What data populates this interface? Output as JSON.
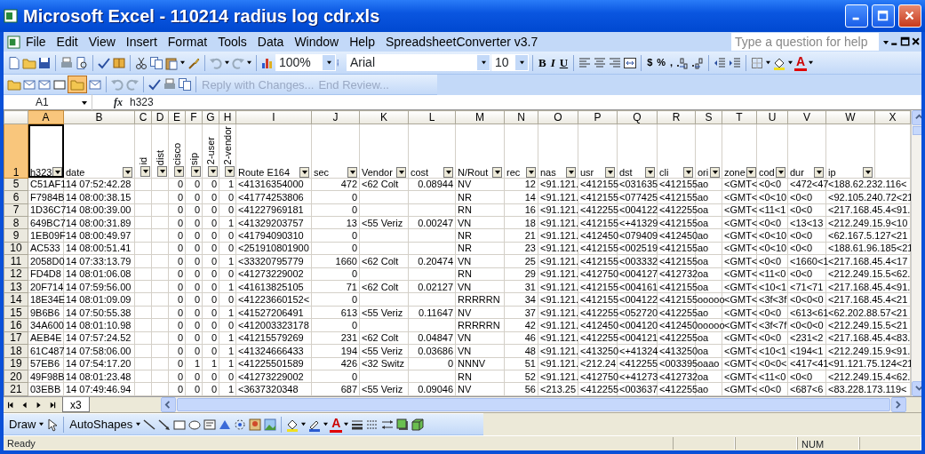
{
  "window": {
    "title": "Microsoft Excel - 110214 radius log cdr.xls"
  },
  "menu": [
    "File",
    "Edit",
    "View",
    "Insert",
    "Format",
    "Tools",
    "Data",
    "Window",
    "Help",
    "SpreadsheetConverter v3.7"
  ],
  "help_box": {
    "placeholder": "Type a question for help"
  },
  "formatting_toolbar": {
    "zoom": "100%",
    "font": "Arial",
    "font_size": "10",
    "style_buttons": [
      "B",
      "I",
      "U"
    ],
    "number_buttons": [
      "$",
      "%",
      ","
    ],
    "font_color_button": "A"
  },
  "reviewing_toolbar": {
    "buttons": [
      {
        "label": "Reply with Changes...",
        "disabled": true
      },
      {
        "label": "End Review...",
        "disabled": true
      }
    ]
  },
  "formula_bar": {
    "name_box": "A1",
    "function_label": "fx",
    "value": "h323"
  },
  "sheet": {
    "header_row": {
      "number": "1",
      "selected": true
    },
    "columns": [
      {
        "letter": "A",
        "header": "h323",
        "kind": "text",
        "rotated": false,
        "filter": true,
        "selected": true
      },
      {
        "letter": "B",
        "header": "date",
        "kind": "text",
        "rotated": false,
        "filter": true,
        "selected": false
      },
      {
        "letter": "C",
        "header": "id",
        "rotated": true,
        "filter": true,
        "selected": false
      },
      {
        "letter": "D",
        "header": "dist",
        "rotated": true,
        "filter": true,
        "selected": false
      },
      {
        "letter": "E",
        "header": "cisco",
        "kind": "number",
        "rotated": true,
        "filter": true,
        "selected": false
      },
      {
        "letter": "F",
        "header": "sip",
        "kind": "number",
        "rotated": true,
        "filter": true,
        "selected": false
      },
      {
        "letter": "G",
        "header": "2-user",
        "kind": "number",
        "rotated": true,
        "filter": true,
        "selected": false
      },
      {
        "letter": "H",
        "header": "2-vendor",
        "kind": "number",
        "rotated": true,
        "filter": true,
        "selected": false
      },
      {
        "letter": "I",
        "header": "Route E164",
        "kind": "text",
        "rotated": false,
        "filter": true,
        "selected": false
      },
      {
        "letter": "J",
        "header": "sec",
        "kind": "number",
        "rotated": false,
        "filter": true,
        "selected": false
      },
      {
        "letter": "K",
        "header": "Vendor",
        "kind": "text",
        "rotated": false,
        "filter": true,
        "selected": false
      },
      {
        "letter": "L",
        "header": "cost",
        "kind": "number",
        "rotated": false,
        "filter": true,
        "selected": false
      },
      {
        "letter": "M",
        "header": "N/Rout",
        "kind": "text",
        "rotated": false,
        "filter": true,
        "selected": false
      },
      {
        "letter": "N",
        "header": "rec",
        "kind": "number",
        "rotated": false,
        "filter": true,
        "selected": false
      },
      {
        "letter": "O",
        "header": "nas",
        "kind": "text",
        "rotated": false,
        "filter": true,
        "selected": false
      },
      {
        "letter": "P",
        "header": "usr",
        "kind": "text",
        "rotated": false,
        "filter": true,
        "selected": false
      },
      {
        "letter": "Q",
        "header": "dst",
        "kind": "text",
        "rotated": false,
        "filter": true,
        "selected": false
      },
      {
        "letter": "R",
        "header": "cli",
        "kind": "text",
        "rotated": false,
        "filter": true,
        "selected": false
      },
      {
        "letter": "S",
        "header": "ori",
        "kind": "text",
        "rotated": false,
        "filter": true,
        "selected": false
      },
      {
        "letter": "T",
        "header": "zone",
        "kind": "text",
        "rotated": false,
        "filter": true,
        "selected": false
      },
      {
        "letter": "U",
        "header": "cod",
        "kind": "text",
        "rotated": false,
        "filter": true,
        "selected": false
      },
      {
        "letter": "V",
        "header": "dur",
        "kind": "text",
        "rotated": false,
        "filter": true,
        "selected": false
      },
      {
        "letter": "W",
        "header": "ip",
        "kind": "text",
        "rotated": false,
        "filter": true,
        "selected": false
      },
      {
        "letter": "X",
        "rotated": false,
        "filter": false,
        "selected": false
      }
    ],
    "rows": [
      {
        "number": "5",
        "cells": [
          "C51AF1",
          "14 07:52:42.28",
          null,
          null,
          "0",
          "0",
          "0",
          "1",
          "<41316354000",
          "472",
          "<62 Colt",
          "0.08944",
          "NV",
          "12",
          "<91.121.",
          "<412155",
          "<031635",
          "<412155",
          "ao",
          "<GMT<",
          "<0<0",
          "<472<47",
          {
            "text": "<188.62.232.116<",
            "colspan": 2
          }
        ]
      },
      {
        "number": "6",
        "cells": [
          "F7984B",
          "14 08:00:38.15",
          null,
          null,
          "0",
          "0",
          "0",
          "0",
          "<41774253806",
          "0",
          null,
          null,
          "NR",
          "14",
          "<91.121.",
          "<412155",
          "<077425",
          "<412155",
          "ao",
          "<GMT<",
          "<0<10",
          "<0<0",
          {
            "text": "<92.105.240.72<21",
            "colspan": 2
          }
        ]
      },
      {
        "number": "7",
        "cells": [
          "1D36C7",
          "14 08:00:39.00",
          null,
          null,
          "0",
          "0",
          "0",
          "0",
          "<41227969181",
          "0",
          null,
          null,
          "RN",
          "16",
          "<91.121.",
          "<412255",
          "<004122",
          "<412255",
          "oa",
          "<GMT<",
          "<11<1",
          "<0<0",
          {
            "text": "<217.168.45.4<91.",
            "colspan": 2
          }
        ]
      },
      {
        "number": "8",
        "cells": [
          "649BC7",
          "14 08:00:31.89",
          null,
          null,
          "0",
          "0",
          "0",
          "1",
          "<41329203757",
          "13",
          "<55 Veriz",
          "0.00247",
          "VN",
          "18",
          "<91.121.",
          "<412155",
          "<+41329",
          "<412155",
          "oa",
          "<GMT<",
          "<0<0",
          "<13<13",
          {
            "text": "<212.249.15.9<10",
            "colspan": 2
          }
        ]
      },
      {
        "number": "9",
        "cells": [
          "1EB09F",
          "14 08:00:49.97",
          null,
          null,
          "0",
          "0",
          "0",
          "0",
          "<41794090310",
          "0",
          null,
          null,
          "NR",
          "21",
          "<91.121.",
          "<412450",
          "<079409",
          "<412450",
          "ao",
          "<GMT<",
          "<0<10",
          "<0<0",
          {
            "text": "<62.167.5.127<21",
            "colspan": 2
          }
        ]
      },
      {
        "number": "10",
        "cells": [
          "AC533",
          "14 08:00:51.41",
          null,
          null,
          "0",
          "0",
          "0",
          "0",
          "<251910801900",
          "0",
          null,
          null,
          "NR",
          "23",
          "<91.121.",
          "<412155",
          "<002519",
          "<412155",
          "ao",
          "<GMT<",
          "<0<10",
          "<0<0",
          {
            "text": "<188.61.96.185<21",
            "colspan": 2
          }
        ]
      },
      {
        "number": "11",
        "cells": [
          "2058D0",
          "14 07:33:13.79",
          null,
          null,
          "0",
          "0",
          "0",
          "1",
          "<33320795779",
          "1660",
          "<62 Colt",
          "0.20474",
          "VN",
          "25",
          "<91.121.",
          "<412155",
          "<003332",
          "<412155",
          "oa",
          "<GMT<",
          "<0<0",
          "<1660<1",
          {
            "text": "<217.168.45.4<17",
            "colspan": 2
          }
        ]
      },
      {
        "number": "12",
        "cells": [
          "FD4D8",
          "14 08:01:06.08",
          null,
          null,
          "0",
          "0",
          "0",
          "0",
          "<41273229002",
          "0",
          null,
          null,
          "RN",
          "29",
          "<91.121.",
          "<412750",
          "<004127",
          "<412732",
          "oa",
          "<GMT<",
          "<11<0",
          "<0<0",
          {
            "text": "<212.249.15.5<62.",
            "colspan": 2
          }
        ]
      },
      {
        "number": "13",
        "cells": [
          "20F714",
          "14 07:59:56.00",
          null,
          null,
          "0",
          "0",
          "0",
          "1",
          "<41613825105",
          "71",
          "<62 Colt",
          "0.02127",
          "VN",
          "31",
          "<91.121.",
          "<412155",
          "<004161",
          "<412155",
          "oa",
          "<GMT<",
          "<10<1",
          "<71<71",
          {
            "text": "<217.168.45.4<91.",
            "colspan": 2
          }
        ]
      },
      {
        "number": "14",
        "cells": [
          "18E34E",
          "14 08:01:09.09",
          null,
          null,
          "0",
          "0",
          "0",
          "0",
          "<41223660152<",
          "0",
          null,
          null,
          "RRRRRN",
          "34",
          "<91.121.",
          "<412155",
          "<004122",
          "<412155",
          "ooooo",
          "<GMT<",
          "<3f<3f",
          "<0<0<0",
          {
            "text": "<217.168.45.4<21",
            "colspan": 2
          }
        ]
      },
      {
        "number": "15",
        "cells": [
          "9B6B6",
          "14 07:50:55.38",
          null,
          null,
          "0",
          "0",
          "0",
          "1",
          "<41527206491",
          "613",
          "<55 Veriz",
          "0.11647",
          "NV",
          "37",
          "<91.121.",
          "<412255",
          "<052720",
          "<412255",
          "ao",
          "<GMT<",
          "<0<0",
          "<613<61",
          {
            "text": "<62.202.88.57<21",
            "colspan": 2
          }
        ]
      },
      {
        "number": "16",
        "cells": [
          "34A600",
          "14 08:01:10.98",
          null,
          null,
          "0",
          "0",
          "0",
          "0",
          "<412003323178",
          "0",
          null,
          null,
          "RRRRRN",
          "42",
          "<91.121.",
          "<412450",
          "<004120",
          "<412450",
          "ooooo",
          "<GMT<",
          "<3f<7f",
          "<0<0<0",
          {
            "text": "<212.249.15.5<21",
            "colspan": 2
          }
        ]
      },
      {
        "number": "17",
        "cells": [
          "AEB4E",
          "14 07:57:24.52",
          null,
          null,
          "0",
          "0",
          "0",
          "1",
          "<41215579269",
          "231",
          "<62 Colt",
          "0.04847",
          "VN",
          "46",
          "<91.121.",
          "<412255",
          "<004121",
          "<412255",
          "oa",
          "<GMT<",
          "<0<0",
          "<231<2",
          {
            "text": "<217.168.45.4<83.",
            "colspan": 2
          }
        ]
      },
      {
        "number": "18",
        "cells": [
          "61C487",
          "14 07:58:06.00",
          null,
          null,
          "0",
          "0",
          "0",
          "1",
          "<41324666433",
          "194",
          "<55 Veriz",
          "0.03686",
          "VN",
          "48",
          "<91.121.",
          "<413250",
          "<+41324",
          "<413250",
          "oa",
          "<GMT<",
          "<10<1",
          "<194<1",
          {
            "text": "<212.249.15.9<91.",
            "colspan": 2
          }
        ]
      },
      {
        "number": "19",
        "cells": [
          "57EB6",
          "14 07:54:17.20",
          null,
          null,
          "0",
          "1",
          "1",
          "1",
          "<41225501589",
          "426",
          "<32 Switz",
          "0",
          "NNNV",
          "51",
          "<91.121.",
          "<212.24",
          "<412255",
          "<003395",
          "oaao",
          "<GMT<",
          "<0<0<",
          "<417<41",
          {
            "text": "<91.121.75.124<21",
            "colspan": 2
          }
        ]
      },
      {
        "number": "20",
        "cells": [
          "49F98B",
          "14 08:01:23.48",
          null,
          null,
          "0",
          "0",
          "0",
          "0",
          "<41273229002",
          "0",
          null,
          null,
          "RN",
          "52",
          "<91.121.",
          "<412750",
          "<+41273",
          "<412732",
          "oa",
          "<GMT<",
          "<11<0",
          "<0<0",
          {
            "text": "<212.249.15.4<62.",
            "colspan": 2
          }
        ]
      },
      {
        "number": "21",
        "cells": [
          "03EBB",
          "14 07:49:46.94",
          null,
          null,
          "0",
          "0",
          "0",
          "1",
          "<3637320348",
          "687",
          "<55 Veriz",
          "0.09046",
          "NV",
          "56",
          "<213.25",
          "<412255",
          "<003637",
          "<412255",
          "ao",
          "<GMT<",
          "<0<0",
          "<687<6",
          {
            "text": "<83.228.173.119<",
            "colspan": 2
          }
        ]
      }
    ]
  },
  "sheet_tabs": [
    {
      "label": "x3",
      "selected": true
    }
  ],
  "draw_toolbar": {
    "draw": "Draw",
    "autoshapes": "AutoShapes",
    "font_color_button": "A"
  },
  "status_bar": {
    "text": "Ready",
    "indicators": [
      "NUM"
    ]
  }
}
